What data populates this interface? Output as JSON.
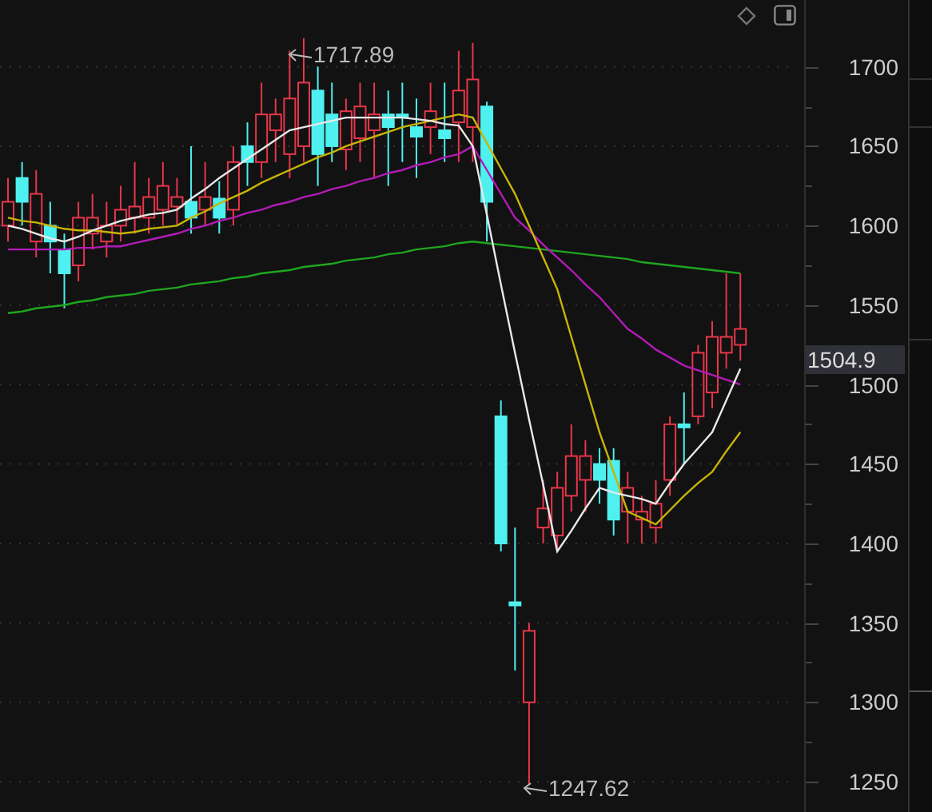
{
  "chart_data": {
    "type": "candlestick",
    "grid": true,
    "ylim": [
      1231,
      1742
    ],
    "yticks": [
      1700,
      1650,
      1600,
      1550,
      1500,
      1450,
      1400,
      1350,
      1300,
      1250
    ],
    "ohlc": [
      [
        1600,
        1630,
        1590,
        1615
      ],
      [
        1630,
        1640,
        1600,
        1615
      ],
      [
        1590,
        1635,
        1580,
        1620
      ],
      [
        1600,
        1615,
        1570,
        1590
      ],
      [
        1585,
        1595,
        1548,
        1570
      ],
      [
        1575,
        1615,
        1565,
        1605
      ],
      [
        1595,
        1620,
        1585,
        1605
      ],
      [
        1590,
        1615,
        1580,
        1600
      ],
      [
        1600,
        1625,
        1590,
        1610
      ],
      [
        1605,
        1640,
        1595,
        1612
      ],
      [
        1605,
        1630,
        1595,
        1618
      ],
      [
        1610,
        1640,
        1600,
        1625
      ],
      [
        1612,
        1630,
        1600,
        1618
      ],
      [
        1615,
        1650,
        1595,
        1605
      ],
      [
        1610,
        1640,
        1600,
        1618
      ],
      [
        1617,
        1628,
        1595,
        1605
      ],
      [
        1610,
        1650,
        1600,
        1640
      ],
      [
        1650,
        1665,
        1625,
        1640
      ],
      [
        1640,
        1690,
        1630,
        1670
      ],
      [
        1660,
        1680,
        1640,
        1670
      ],
      [
        1645,
        1710,
        1630,
        1680
      ],
      [
        1650,
        1718,
        1640,
        1690
      ],
      [
        1685,
        1700,
        1625,
        1645
      ],
      [
        1670,
        1690,
        1640,
        1650
      ],
      [
        1648,
        1680,
        1635,
        1672
      ],
      [
        1655,
        1690,
        1640,
        1675
      ],
      [
        1660,
        1690,
        1630,
        1670
      ],
      [
        1670,
        1685,
        1625,
        1662
      ],
      [
        1670,
        1690,
        1640,
        1668
      ],
      [
        1662,
        1680,
        1630,
        1656
      ],
      [
        1662,
        1690,
        1645,
        1672
      ],
      [
        1660,
        1690,
        1640,
        1655
      ],
      [
        1665,
        1710,
        1640,
        1685
      ],
      [
        1662,
        1715,
        1640,
        1692
      ],
      [
        1675,
        1678,
        1590,
        1615
      ],
      [
        1480,
        1490,
        1395,
        1400
      ],
      [
        1363,
        1410,
        1320,
        1361
      ],
      [
        1300,
        1350,
        1248,
        1345
      ],
      [
        1410,
        1440,
        1400,
        1422
      ],
      [
        1405,
        1445,
        1395,
        1435
      ],
      [
        1430,
        1475,
        1420,
        1455
      ],
      [
        1440,
        1465,
        1420,
        1455
      ],
      [
        1450,
        1460,
        1425,
        1440
      ],
      [
        1452,
        1460,
        1405,
        1415
      ],
      [
        1420,
        1445,
        1400,
        1435
      ],
      [
        1415,
        1430,
        1400,
        1420
      ],
      [
        1410,
        1440,
        1400,
        1425
      ],
      [
        1440,
        1480,
        1430,
        1475
      ],
      [
        1475,
        1495,
        1450,
        1473
      ],
      [
        1480,
        1525,
        1475,
        1520
      ],
      [
        1495,
        1540,
        1485,
        1530
      ],
      [
        1520,
        1570,
        1510,
        1530
      ],
      [
        1525,
        1570,
        1515,
        1535
      ]
    ],
    "series": [
      {
        "type": "line",
        "color": "#1fa51f",
        "values": [
          1545,
          1546,
          1548,
          1549,
          1550,
          1552,
          1553,
          1555,
          1556,
          1557,
          1559,
          1560,
          1561,
          1563,
          1564,
          1565,
          1567,
          1568,
          1570,
          1571,
          1572,
          1574,
          1575,
          1576,
          1578,
          1579,
          1580,
          1582,
          1583,
          1585,
          1586,
          1587,
          1589,
          1590,
          1589,
          1588,
          1587,
          1586,
          1585,
          1584,
          1583,
          1582,
          1581,
          1580,
          1579,
          1577,
          1576,
          1575,
          1574,
          1573,
          1572,
          1571,
          1570
        ]
      },
      {
        "type": "line",
        "color": "#b21bb5",
        "values": [
          1585,
          1585,
          1585,
          1585,
          1585,
          1586,
          1586,
          1587,
          1587,
          1589,
          1591,
          1593,
          1595,
          1598,
          1600,
          1603,
          1605,
          1608,
          1610,
          1613,
          1615,
          1618,
          1620,
          1623,
          1625,
          1628,
          1630,
          1633,
          1635,
          1638,
          1640,
          1643,
          1645,
          1650,
          1635,
          1620,
          1605,
          1597,
          1588,
          1580,
          1572,
          1563,
          1555,
          1545,
          1535,
          1529,
          1522,
          1517,
          1512,
          1509,
          1506,
          1503,
          1500
        ]
      },
      {
        "type": "line",
        "color": "#c7b40a",
        "values": [
          1605,
          1603,
          1602,
          1600,
          1598,
          1597,
          1597,
          1596,
          1595,
          1596,
          1598,
          1599,
          1600,
          1605,
          1609,
          1614,
          1618,
          1622,
          1627,
          1631,
          1635,
          1639,
          1643,
          1646,
          1650,
          1653,
          1656,
          1659,
          1662,
          1664,
          1666,
          1668,
          1670,
          1668,
          1652,
          1636,
          1620,
          1600,
          1580,
          1560,
          1530,
          1500,
          1470,
          1445,
          1420,
          1416,
          1412,
          1421,
          1430,
          1438,
          1445,
          1458,
          1470
        ]
      },
      {
        "type": "line",
        "color": "#e8e8e8",
        "values": [
          1600,
          1598,
          1595,
          1592,
          1590,
          1593,
          1597,
          1600,
          1603,
          1605,
          1607,
          1608,
          1610,
          1617,
          1623,
          1630,
          1636,
          1642,
          1648,
          1654,
          1660,
          1662,
          1664,
          1666,
          1668,
          1668,
          1668,
          1668,
          1668,
          1667,
          1666,
          1664,
          1663,
          1650,
          1607,
          1563,
          1520,
          1478,
          1437,
          1395,
          1408,
          1422,
          1435,
          1432,
          1430,
          1428,
          1425,
          1438,
          1450,
          1460,
          1470,
          1490,
          1510
        ]
      }
    ]
  },
  "last_price_tag": "1504.9",
  "high_marker": "1717.89",
  "low_marker": "1247.62"
}
